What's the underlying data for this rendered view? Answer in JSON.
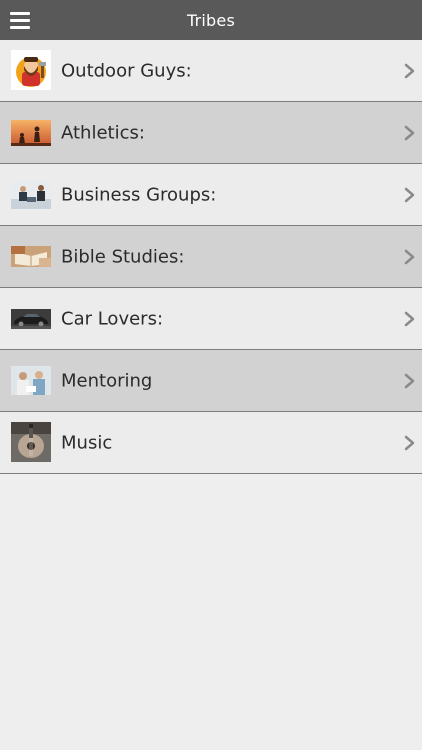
{
  "header": {
    "title": "Tribes",
    "menu_icon": "hamburger-menu-icon"
  },
  "tribes": [
    {
      "label": "Outdoor Guys:",
      "icon": "lumberjack-avatar-image"
    },
    {
      "label": "Athletics:",
      "icon": "sunset-athletes-image"
    },
    {
      "label": "Business Groups:",
      "icon": "business-meeting-image"
    },
    {
      "label": "Bible Studies:",
      "icon": "bible-reading-image"
    },
    {
      "label": "Car Lovers:",
      "icon": "car-image"
    },
    {
      "label": "Mentoring",
      "icon": "mentoring-image"
    },
    {
      "label": "Music",
      "icon": "guitar-image"
    }
  ],
  "colors": {
    "header_bg": "#595959",
    "row_light": "#ececec",
    "row_dark": "#d2d2d2",
    "divider": "#7d7d7d",
    "chevron": "#8a8a8a"
  }
}
